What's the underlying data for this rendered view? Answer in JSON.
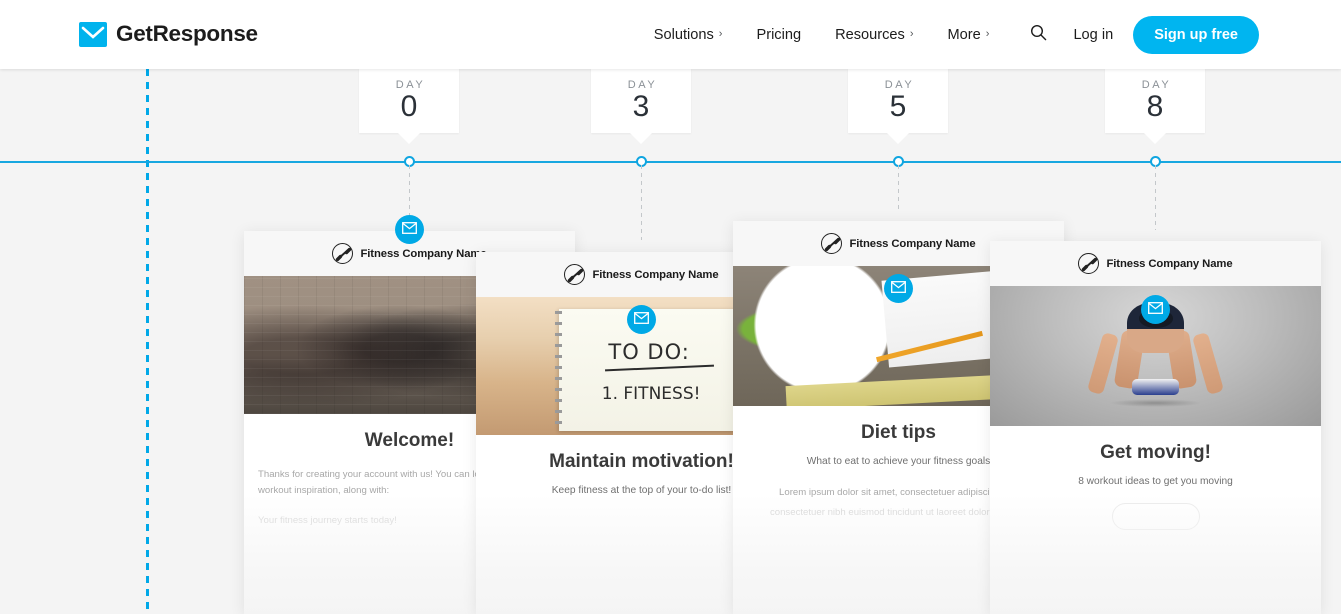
{
  "header": {
    "brand": {
      "name": "GetResponse",
      "icon": "envelope-logo-icon",
      "color": "#00b3ed"
    },
    "nav": [
      {
        "label": "Solutions",
        "has_chevron": true,
        "chevron": "›"
      },
      {
        "label": "Pricing",
        "has_chevron": false,
        "chevron": ""
      },
      {
        "label": "Resources",
        "has_chevron": true,
        "chevron": "›"
      },
      {
        "label": "More",
        "has_chevron": true,
        "chevron": "›"
      }
    ],
    "search_icon": "search-icon",
    "login_label": "Log in",
    "signup_label": "Sign up free",
    "accent_color": "#00b5f0"
  },
  "timeline": {
    "line_color": "#17a7e0",
    "node_color": "#0fa5e0",
    "day_label": "DAY",
    "days": [
      {
        "label": "DAY",
        "number": "0"
      },
      {
        "label": "DAY",
        "number": "3"
      },
      {
        "label": "DAY",
        "number": "5"
      },
      {
        "label": "DAY",
        "number": "8"
      }
    ]
  },
  "guide_line_color": "#00a8e8",
  "emails": [
    {
      "badge_icon": "envelope-icon",
      "company": "Fitness Company Name",
      "logo_icon": "dumbbell-circle-icon",
      "hero": "gym-group-workout-photo",
      "title": "Welcome!",
      "sub": "",
      "paragraph": "Thanks for creating your account with us! You can loo",
      "paragraph_line2": "workout inspiration, along with:",
      "paragraph_faded": "Your fitness journey starts today!"
    },
    {
      "badge_icon": "envelope-icon",
      "company": "Fitness Company Name",
      "logo_icon": "dumbbell-circle-icon",
      "hero": "todo-notepad-photo",
      "hero_text_1": "TO DO:",
      "hero_text_2": "1. FITNESS!",
      "title": "Maintain motivation!",
      "sub": "Keep fitness at the top of your to-do list!",
      "paragraph": "",
      "paragraph_faded": ""
    },
    {
      "badge_icon": "envelope-icon",
      "company": "Fitness Company Name",
      "logo_icon": "dumbbell-circle-icon",
      "hero": "salad-notepad-measuring-tape-photo",
      "title": "Diet tips",
      "sub": "What to eat to achieve your fitness goals",
      "paragraph": "Lorem ipsum dolor sit amet, consectetuer adipiscing elit,",
      "paragraph_faded": "consectetuer nibh euismod tincidunt ut laoreet dolore magna"
    },
    {
      "badge_icon": "envelope-icon",
      "company": "Fitness Company Name",
      "logo_icon": "dumbbell-circle-icon",
      "hero": "sprinter-starting-block-photo",
      "title": "Get moving!",
      "sub": "8 workout ideas to get you moving",
      "paragraph": "",
      "paragraph_faded": ""
    }
  ]
}
